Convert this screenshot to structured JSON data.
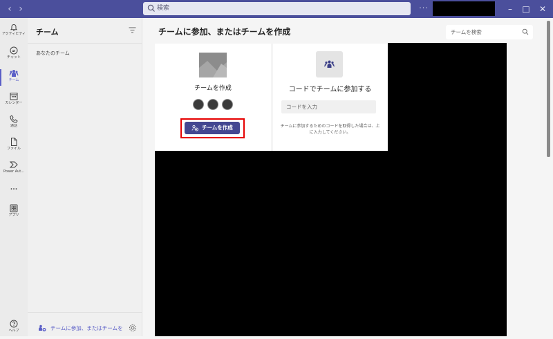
{
  "titlebar": {
    "search_placeholder": "検索",
    "more": "···",
    "window_buttons": {
      "minimize": "–",
      "maximize": "□",
      "close": "✕"
    }
  },
  "rail": {
    "items": [
      {
        "id": "activity",
        "label": "アクティビティ",
        "icon": "bell-icon"
      },
      {
        "id": "chat",
        "label": "チャット",
        "icon": "chat-icon"
      },
      {
        "id": "teams",
        "label": "チーム",
        "icon": "teams-icon",
        "active": true
      },
      {
        "id": "calendar",
        "label": "カレンダー",
        "icon": "calendar-icon"
      },
      {
        "id": "calls",
        "label": "通話",
        "icon": "phone-icon"
      },
      {
        "id": "files",
        "label": "ファイル",
        "icon": "file-icon"
      },
      {
        "id": "power-automate",
        "label": "Power Aut...",
        "icon": "power-automate-icon"
      },
      {
        "id": "more",
        "label": "",
        "icon": "more-dots-icon"
      },
      {
        "id": "apps",
        "label": "アプリ",
        "icon": "apps-icon"
      },
      {
        "id": "help",
        "label": "ヘルプ",
        "icon": "help-icon"
      }
    ]
  },
  "panel": {
    "title": "チーム",
    "section": "あなたのチーム",
    "footer_link": "チームに参加、またはチームを..."
  },
  "main": {
    "title": "チームに参加、またはチームを作成",
    "search_placeholder": "チームを検索",
    "create_card": {
      "title": "チームを作成",
      "button_label": "チームを作成"
    },
    "join_card": {
      "title": "コードでチームに参加する",
      "input_placeholder": "コードを入力",
      "help_text": "チームに参加するためのコードを取得した場合は、上に入力してください。"
    }
  },
  "colors": {
    "brand": "#4b4f9c",
    "button": "#444791",
    "accent": "#5b5fc7",
    "highlight": "#e60000"
  }
}
